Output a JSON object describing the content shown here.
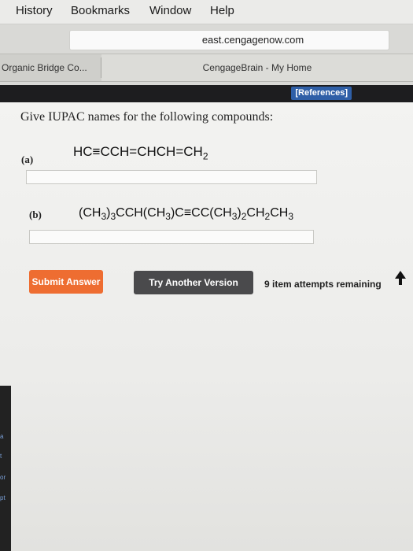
{
  "menubar": {
    "items": [
      "History",
      "Bookmarks",
      "Window",
      "Help"
    ]
  },
  "browser": {
    "url": "east.cengagenow.com",
    "tabs": [
      "Organic Bridge Co...",
      "CengageBrain - My Home"
    ]
  },
  "toolbar": {
    "references_label": "[References]"
  },
  "question": {
    "prompt": "Give IUPAC names for the following compounds:",
    "parts": [
      {
        "label": "(a)",
        "formula_text": "HC≡CCH=CHCH=CH₂"
      },
      {
        "label": "(b)",
        "formula_text": "(CH₃)₃CCH(CH₃)C≡CC(CH₃)₂CH₂CH₃"
      }
    ]
  },
  "actions": {
    "submit_label": "Submit Answer",
    "try_label": "Try Another Version",
    "attempts_text": "9 item attempts remaining"
  },
  "side_strip": {
    "glyphs": [
      "a",
      "t",
      "or",
      "pt"
    ]
  },
  "colors": {
    "submit_button": "#ee6d31",
    "try_button": "#4a4a4c",
    "references_button": "#2f5fa7"
  }
}
